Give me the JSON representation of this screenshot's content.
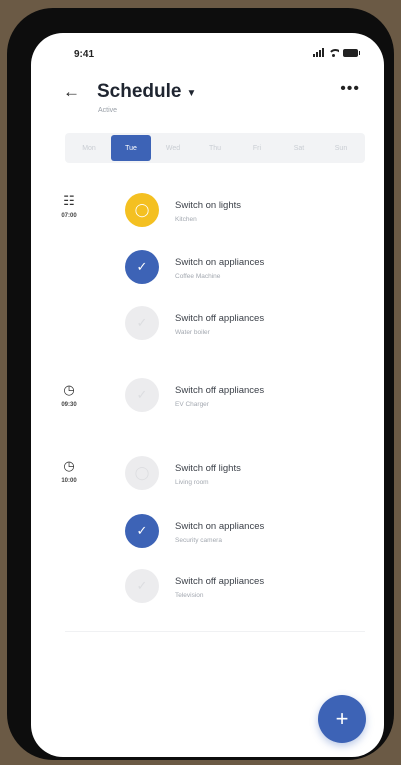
{
  "status_bar": {
    "time": "9:41"
  },
  "header": {
    "title": "Schedule",
    "subtitle": "Active"
  },
  "days": [
    {
      "label": "Mon",
      "active": false
    },
    {
      "label": "Tue",
      "active": true
    },
    {
      "label": "Wed",
      "active": false
    },
    {
      "label": "Thu",
      "active": false
    },
    {
      "label": "Fri",
      "active": false
    },
    {
      "label": "Sat",
      "active": false
    },
    {
      "label": "Sun",
      "active": false
    }
  ],
  "groups": [
    {
      "time": "07:00",
      "icon": "sunrise-icon",
      "items": [
        {
          "title": "Switch on lights",
          "subtitle": "Kitchen",
          "color": "yellow",
          "icon": "lightbulb-icon"
        },
        {
          "title": "Switch on appliances",
          "subtitle": "Coffee Machine",
          "color": "blue",
          "icon": "plug-icon"
        },
        {
          "title": "Switch off appliances",
          "subtitle": "Water boiler",
          "color": "grey",
          "icon": "plug-icon"
        }
      ]
    },
    {
      "time": "09:30",
      "icon": "clock-icon",
      "items": [
        {
          "title": "Switch off appliances",
          "subtitle": "EV Charger",
          "color": "grey",
          "icon": "plug-icon"
        }
      ]
    },
    {
      "time": "10:00",
      "icon": "clock-icon",
      "items": [
        {
          "title": "Switch off lights",
          "subtitle": "Living room",
          "color": "grey",
          "icon": "lightbulb-icon"
        },
        {
          "title": "Switch on appliances",
          "subtitle": "Security camera",
          "color": "blue",
          "icon": "plug-icon"
        },
        {
          "title": "Switch off appliances",
          "subtitle": "Television",
          "color": "grey",
          "icon": "plug-icon"
        }
      ]
    }
  ],
  "colors": {
    "accent": "#3d63b6",
    "yellow": "#f4c021",
    "grey": "#ececee"
  }
}
